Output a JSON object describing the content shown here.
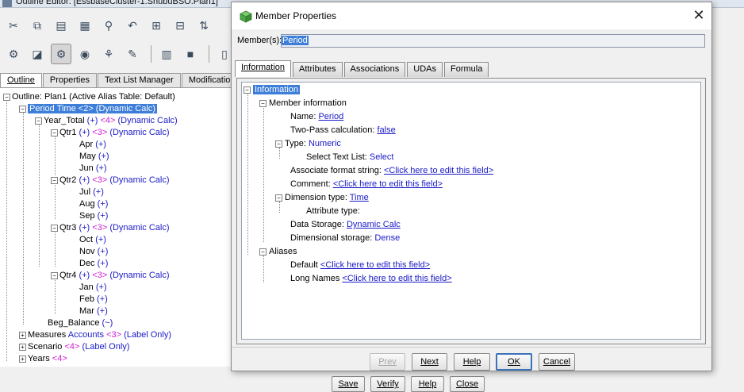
{
  "background": {
    "window_title": "Outline Editor: [EssbaseCluster-1.ShubuBSO.Plan1]",
    "tabs": [
      {
        "label": "Outline",
        "active": true
      },
      {
        "label": "Properties",
        "active": false
      },
      {
        "label": "Text List Manager",
        "active": false
      },
      {
        "label": "Modification",
        "active": false
      }
    ],
    "tree": [
      {
        "text": "Outline: Plan1 (Active Alias Table: Default)"
      },
      {
        "name": "Period Time",
        "count": "<2>",
        "extra": "(Dynamic Calc)"
      },
      {
        "name": "Year_Total",
        "op": "(+)",
        "count": "<4>",
        "extra": "(Dynamic Calc)"
      },
      {
        "name": "Qtr1",
        "op": "(+)",
        "count": "<3>",
        "extra": "(Dynamic Calc)"
      },
      {
        "name": "Apr",
        "op": "(+)"
      },
      {
        "name": "May",
        "op": "(+)"
      },
      {
        "name": "Jun",
        "op": "(+)"
      },
      {
        "name": "Qtr2",
        "op": "(+)",
        "count": "<3>",
        "extra": "(Dynamic Calc)"
      },
      {
        "name": "Jul",
        "op": "(+)"
      },
      {
        "name": "Aug",
        "op": "(+)"
      },
      {
        "name": "Sep",
        "op": "(+)"
      },
      {
        "name": "Qtr3",
        "op": "(+)",
        "count": "<3>",
        "extra": "(Dynamic Calc)"
      },
      {
        "name": "Oct",
        "op": "(+)"
      },
      {
        "name": "Nov",
        "op": "(+)"
      },
      {
        "name": "Dec",
        "op": "(+)"
      },
      {
        "name": "Qtr4",
        "op": "(+)",
        "count": "<3>",
        "extra": "(Dynamic Calc)"
      },
      {
        "name": "Jan",
        "op": "(+)"
      },
      {
        "name": "Feb",
        "op": "(+)"
      },
      {
        "name": "Mar",
        "op": "(+)"
      },
      {
        "name": "Beg_Balance",
        "op": "(~)"
      },
      {
        "name": "Measures",
        "kind": "Accounts",
        "count": "<3>",
        "extra": "(Label Only)"
      },
      {
        "name": "Scenario",
        "count": "<4>",
        "extra": "(Label Only)"
      },
      {
        "name": "Years",
        "count": "<4>"
      }
    ],
    "bottom_buttons": {
      "save": "Save",
      "verify": "Verify",
      "help": "Help",
      "close": "Close"
    },
    "toolbar_icons": [
      "cut-icon",
      "copy-icon",
      "paste-icon",
      "paste-special-icon",
      "find-icon",
      "undo-icon",
      "add-sibling-icon",
      "sort-icon",
      "add-child-icon",
      "attribute-icon",
      "member-icon",
      "member-properties-icon",
      "dimension-icon",
      "calc-icon",
      "edit-icon",
      "save-icon",
      "panel-icon",
      "restructure-icon"
    ]
  },
  "dialog": {
    "title": "Member Properties",
    "close_glyph": "✕",
    "member_label": "Member(s):",
    "member_value": "Period",
    "tabs": [
      {
        "label": "Information",
        "active": true
      },
      {
        "label": "Attributes",
        "active": false
      },
      {
        "label": "Associations",
        "active": false
      },
      {
        "label": "UDAs",
        "active": false
      },
      {
        "label": "Formula",
        "active": false
      }
    ],
    "tree": {
      "root": "Information",
      "member_information": "Member information",
      "name_label": "Name:",
      "name_value": "Period",
      "two_pass_label": "Two-Pass calculation:",
      "two_pass_value": "false",
      "type_label": "Type:",
      "type_value": "Numeric",
      "select_text_list_label": "Select Text List:",
      "select_text_list_value": "Select",
      "assoc_format_label": "Associate format string:",
      "assoc_format_value": "<Click here to edit this field>",
      "comment_label": "Comment:",
      "comment_value": "<Click here to edit this field>",
      "dim_type_label": "Dimension type:",
      "dim_type_value": "Time",
      "attribute_type_label": "Attribute type:",
      "data_storage_label": "Data Storage:",
      "data_storage_value": "Dynamic Calc",
      "dim_storage_label": "Dimensional storage:",
      "dim_storage_value": "Dense",
      "aliases": "Aliases",
      "default_label": "Default",
      "default_value": "<Click here to edit this field>",
      "long_names_label": "Long Names",
      "long_names_value": "<Click here to edit this field>"
    },
    "buttons": {
      "prev": "Prev",
      "next": "Next",
      "help": "Help",
      "ok": "OK",
      "cancel": "Cancel"
    }
  }
}
